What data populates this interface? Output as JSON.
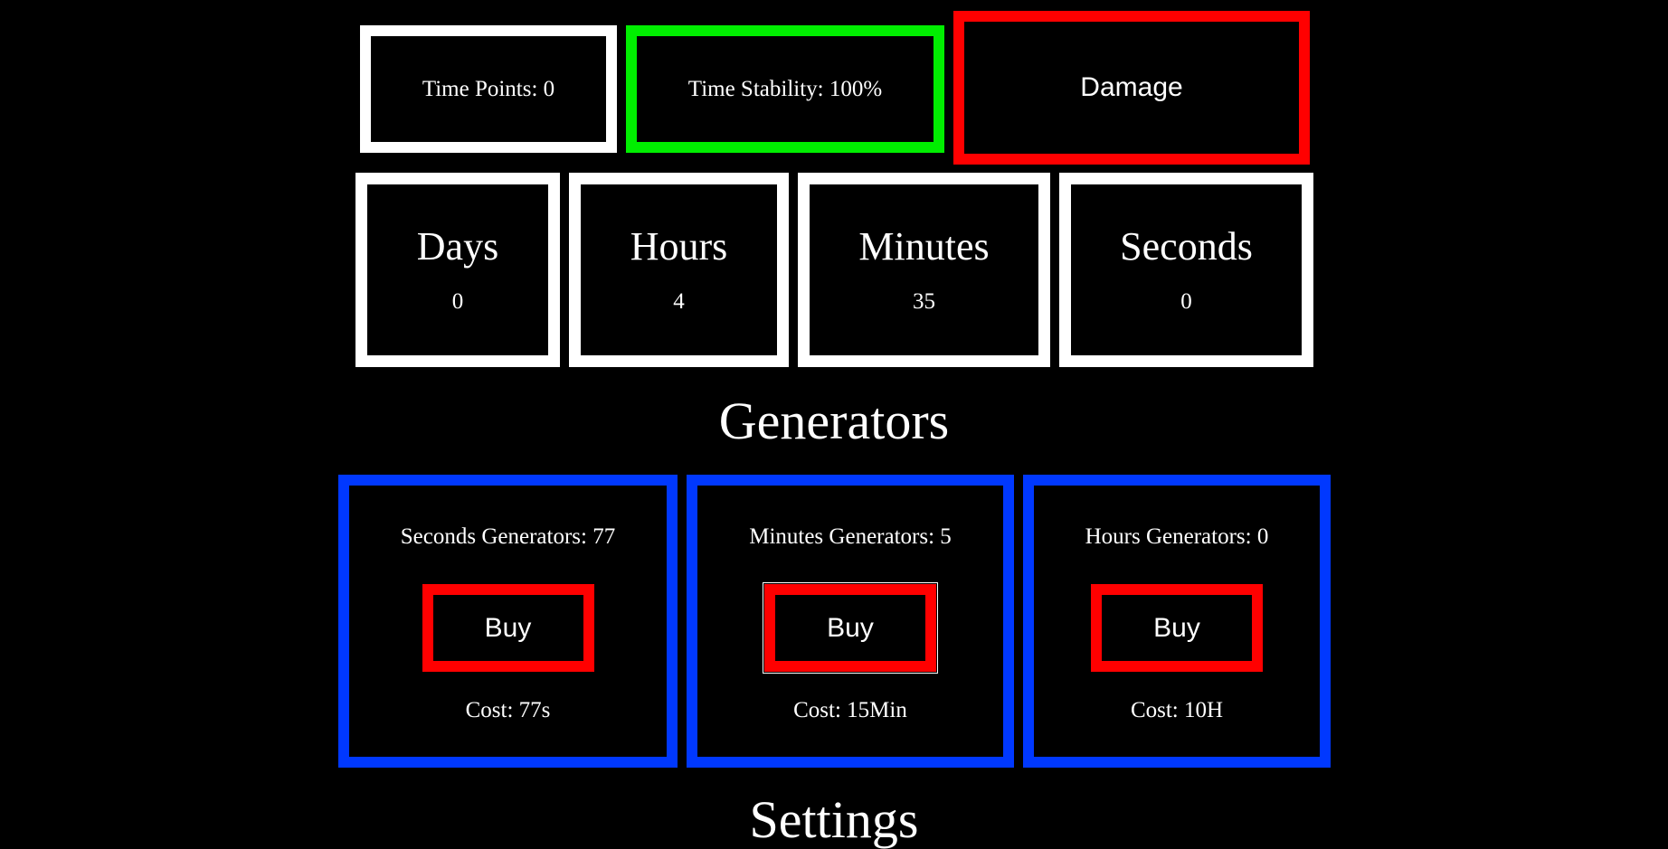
{
  "stats": {
    "time_points": "Time Points: 0",
    "time_stability": "Time Stability: 100%",
    "damage_label": "Damage"
  },
  "units": {
    "days": {
      "label": "Days",
      "value": "0"
    },
    "hours": {
      "label": "Hours",
      "value": "4"
    },
    "minutes": {
      "label": "Minutes",
      "value": "35"
    },
    "seconds": {
      "label": "Seconds",
      "value": "0"
    }
  },
  "generators": {
    "heading": "Generators",
    "items": [
      {
        "count": "Seconds Generators: 77",
        "buy_label": "Buy",
        "cost": "Cost: 77s"
      },
      {
        "count": "Minutes Generators: 5",
        "buy_label": "Buy",
        "cost": "Cost: 15Min"
      },
      {
        "count": "Hours Generators: 0",
        "buy_label": "Buy",
        "cost": "Cost: 10H"
      }
    ]
  },
  "settings": {
    "heading": "Settings"
  },
  "colors": {
    "background": "#000000",
    "text": "#ffffff",
    "stability_border": "#00ee00",
    "damage_border": "#ff0000",
    "generator_border": "#0038ff",
    "buy_border": "#ff0000"
  }
}
